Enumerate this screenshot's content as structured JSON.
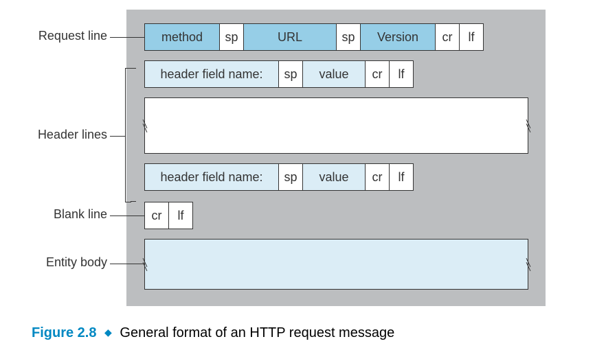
{
  "labels": {
    "request_line": "Request line",
    "header_lines": "Header lines",
    "blank_line": "Blank line",
    "entity_body": "Entity body"
  },
  "row1": {
    "method": "method",
    "sp1": "sp",
    "url": "URL",
    "sp2": "sp",
    "version": "Version",
    "cr": "cr",
    "lf": "lf"
  },
  "header_row": {
    "name": "header field name:",
    "sp": "sp",
    "value": "value",
    "cr": "cr",
    "lf": "lf"
  },
  "blank_row": {
    "cr": "cr",
    "lf": "lf"
  },
  "caption": {
    "figure": "Figure 2.8",
    "text": "General format of an HTTP request message"
  }
}
